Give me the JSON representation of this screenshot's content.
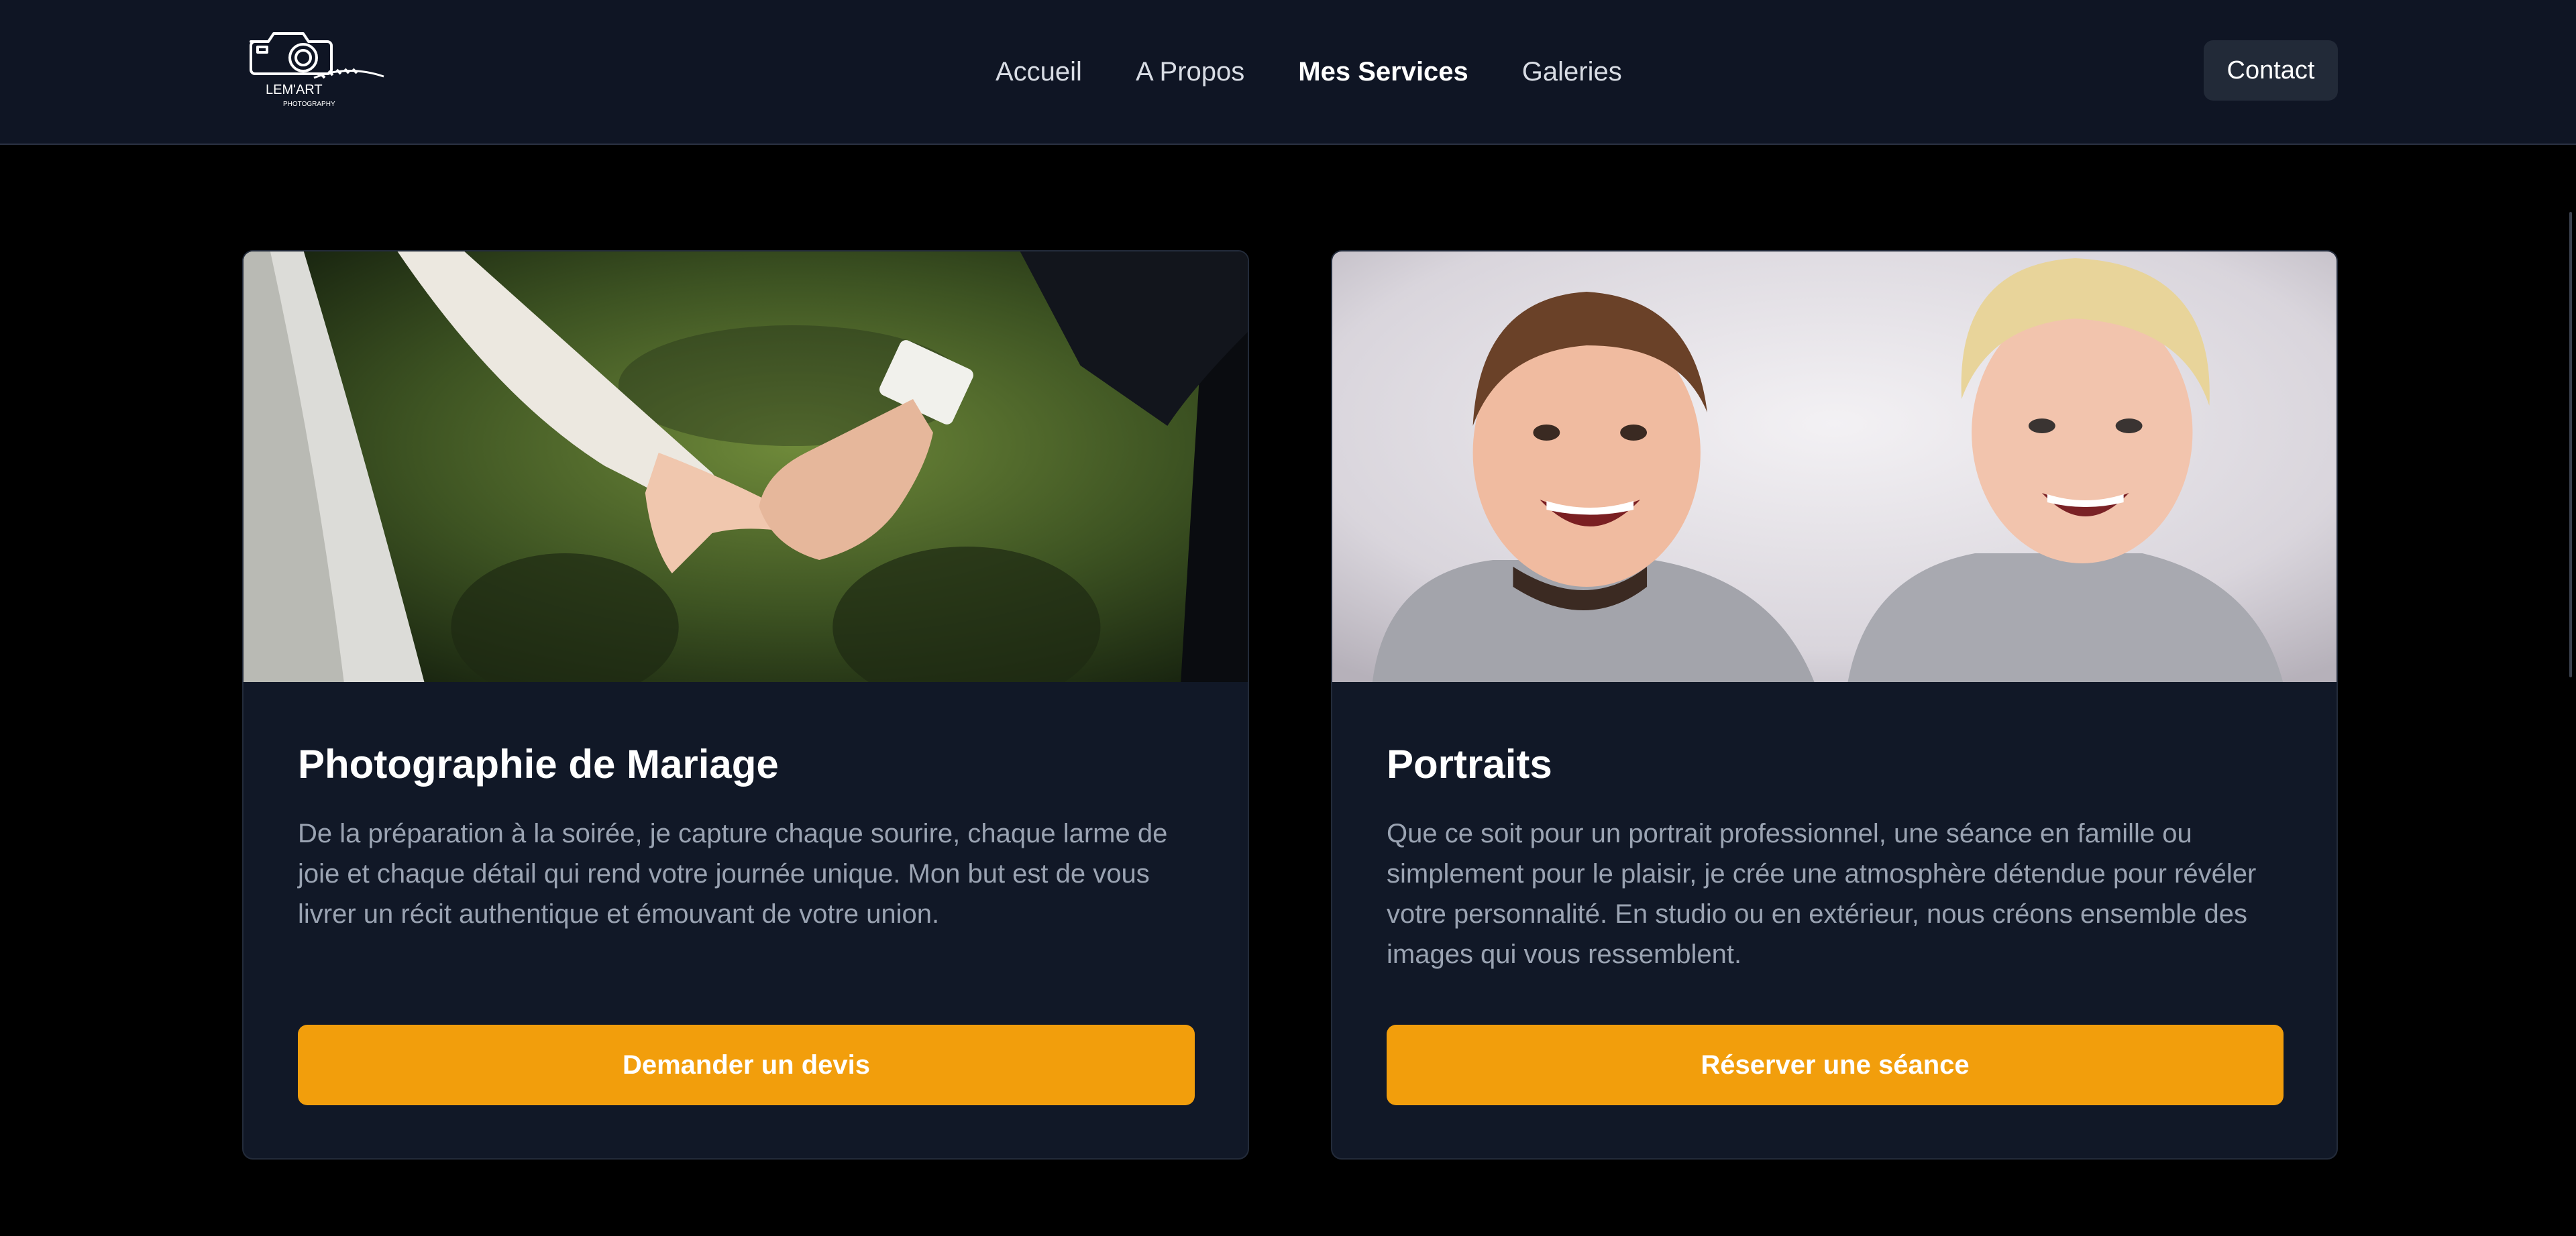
{
  "header": {
    "logo": {
      "name": "LEM'ART",
      "tagline": "PHOTOGRAPHY"
    },
    "nav": [
      {
        "label": "Accueil",
        "active": false
      },
      {
        "label": "A Propos",
        "active": false
      },
      {
        "label": "Mes Services",
        "active": true
      },
      {
        "label": "Galeries",
        "active": false
      }
    ],
    "contact_label": "Contact"
  },
  "services": [
    {
      "title": "Photographie de Mariage",
      "description": "De la préparation à la soirée, je capture chaque sourire, chaque larme de joie et chaque détail qui rend votre journée unique. Mon but est de vous livrer un récit authentique et émouvant de votre union.",
      "button_label": "Demander un devis",
      "image": "wedding-hands-photo"
    },
    {
      "title": "Portraits",
      "description": "Que ce soit pour un portrait professionnel, une séance en famille ou simplement pour le plaisir, je crée une atmosphère détendue pour révéler votre personnalité. En studio ou en extérieur, nous créons ensemble des images qui vous ressemblent.",
      "button_label": "Réserver une séance",
      "image": "laughing-children-photo"
    }
  ],
  "colors": {
    "header_bg": "#0f1524",
    "page_bg": "#000000",
    "card_bg": "#111827",
    "accent": "#f29e0c",
    "body_text": "#9aa3b2"
  }
}
